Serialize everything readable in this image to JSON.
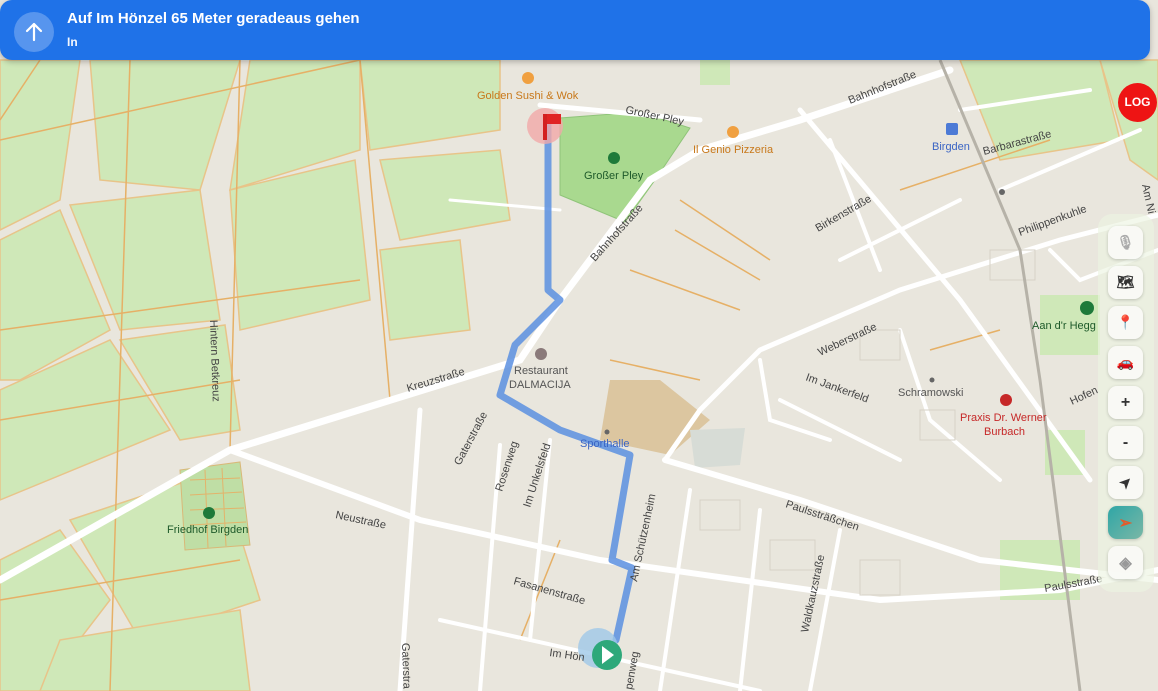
{
  "instruction": {
    "title": "Auf Im Hönzel 65 Meter geradeaus gehen",
    "subtitle": "In"
  },
  "log_label": "LOG",
  "streets": {
    "bahnhofstrasse_ne": "Bahnhofstraße",
    "bahnhofstrasse_diag": "Bahnhofstraße",
    "grosser_pley_street": "Großer Pley",
    "barbarastrasse": "Barbarastraße",
    "birkenstrasse": "Birkenstraße",
    "philippenkuhle": "Philippenkuhle",
    "weberstrasse": "Weberstraße",
    "im_jankerfeld": "Im Jankerfeld",
    "kreuzstrasse": "Kreuzstraße",
    "hintern_betkreuz": "Hintern Betkreuz",
    "gaterstrasse": "Gaterstraße",
    "gaterstrasse_south": "Gaterstra",
    "rosenweg": "Rosenweg",
    "im_unkelsfeld": "Im Unkelsfeld",
    "am_schuetzenheim": "Am Schützenheim",
    "neustrasse": "Neustraße",
    "paulsstraesschen": "Paulssträßchen",
    "paulsstrasse": "Paulsstraße",
    "fasanenstrasse": "Fasanenstraße",
    "waldkauzstrasse": "Waldkauzstraße",
    "im_hoenzel": "Im Hön",
    "penweg": "penweg",
    "am_ni": "Am Ni",
    "hofen": "Hofen"
  },
  "pois": {
    "golden_sushi": "Golden Sushi & Wok",
    "il_genio": "Il Genio Pizzeria",
    "grosser_pley_park": "Großer Pley",
    "birgden_station": "Birgden",
    "restaurant_line1": "Restaurant",
    "restaurant_line2": "DALMACIJA",
    "sporthalle": "Sporthalle",
    "friedhof": "Friedhof Birgden",
    "schramowski": "Schramowski",
    "praxis_line1": "Praxis Dr. Werner",
    "praxis_line2": "Burbach",
    "aan_dr_hegg": "Aan d'r Hegg"
  },
  "controls": [
    {
      "name": "microphone",
      "glyph": "🎙"
    },
    {
      "name": "map",
      "glyph": "🗺"
    },
    {
      "name": "pin",
      "glyph": "📍"
    },
    {
      "name": "car",
      "glyph": "🚗"
    },
    {
      "name": "zoom_in",
      "glyph": "+"
    },
    {
      "name": "zoom_out",
      "glyph": "-"
    },
    {
      "name": "navigate",
      "glyph": "➤"
    },
    {
      "name": "send",
      "glyph": "➢"
    },
    {
      "name": "layers",
      "glyph": "◈"
    }
  ],
  "colors": {
    "banner": "#1f72e8",
    "route": "#5b8fe0",
    "log": "#ee1414",
    "poi_orange": "#c8781a",
    "poi_green": "#1e7a3a",
    "poi_red": "#c62828"
  }
}
